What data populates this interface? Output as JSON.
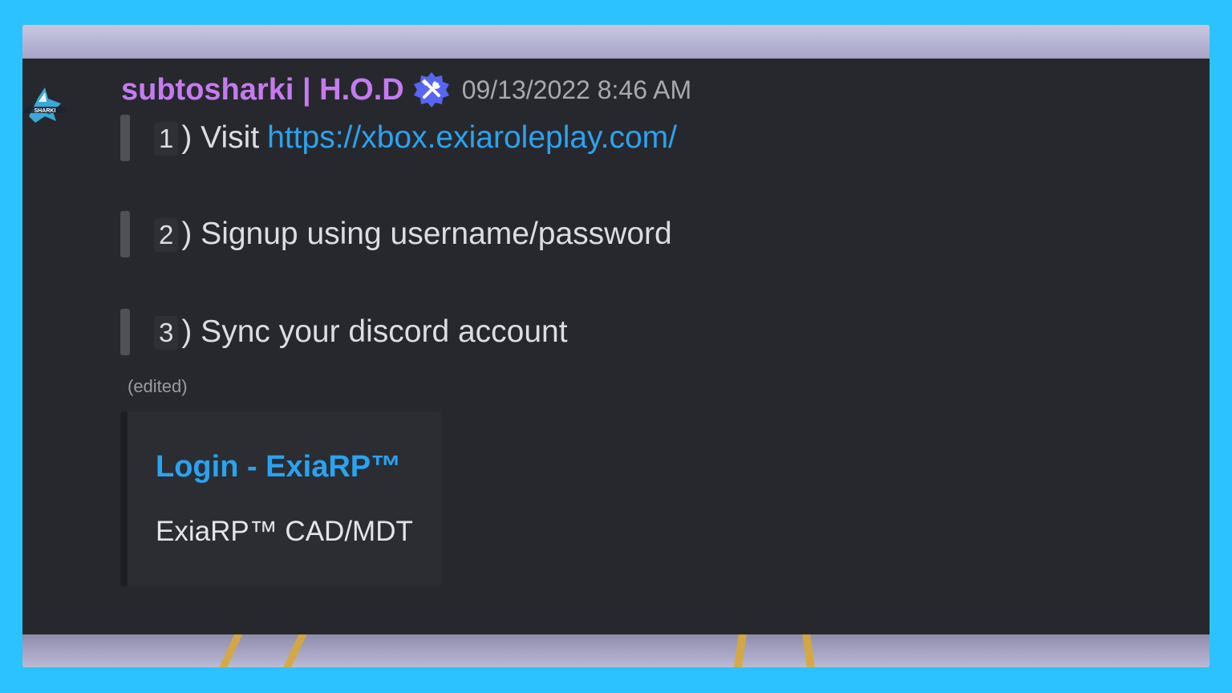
{
  "message": {
    "avatar_icon": "shark-avatar-icon",
    "username": "subtosharki | H.O.D",
    "badge_icon": "tools-badge-icon",
    "timestamp": "09/13/2022 8:46 AM",
    "lines": [
      {
        "number": "1",
        "text": ") Visit",
        "link": "https://xbox.exiaroleplay.com/"
      },
      {
        "number": "2",
        "text": ") Signup using username/password"
      },
      {
        "number": "3",
        "text": ") Sync your discord account"
      }
    ],
    "edited_label": "(edited)",
    "embed": {
      "title": "Login - ExiaRP™",
      "description": "ExiaRP™ CAD/MDT"
    }
  },
  "colors": {
    "outer_background": "#2cc2ff",
    "panel_background": "#27282d",
    "username": "#c57bf0",
    "link": "#2aa3f0",
    "badge": "#5865f2"
  }
}
